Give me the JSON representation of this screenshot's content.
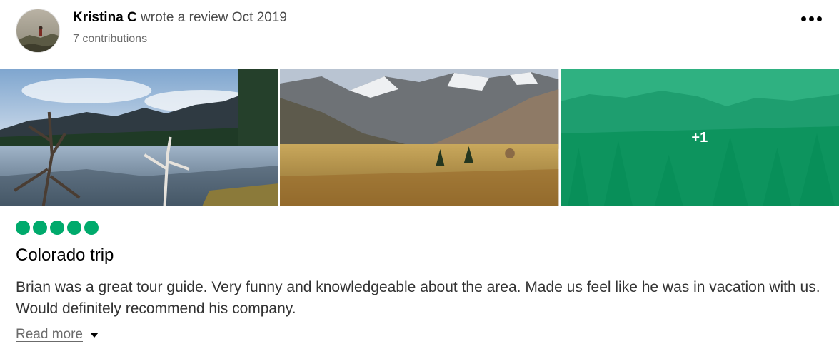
{
  "review": {
    "author": {
      "name": "Kristina C",
      "action": "wrote a review Oct 2019",
      "contributions": "7 contributions",
      "avatar_icon": "user-avatar-photo"
    },
    "menu_icon": "more-options-icon",
    "photos": [
      {
        "name": "lake-with-dead-trees-photo"
      },
      {
        "name": "mountain-meadow-photo"
      },
      {
        "name": "green-forest-mountain-photo",
        "overlay_count": "+1"
      }
    ],
    "rating": {
      "value": 5,
      "max": 5,
      "color": "#00aa6c"
    },
    "title": "Colorado trip",
    "text": "Brian was a great tour guide. Very funny and knowledgeable about the area. Made us feel like he was in vacation with us. Would definitely recommend his company.",
    "read_more": "Read more",
    "read_more_icon": "caret-down-icon"
  }
}
